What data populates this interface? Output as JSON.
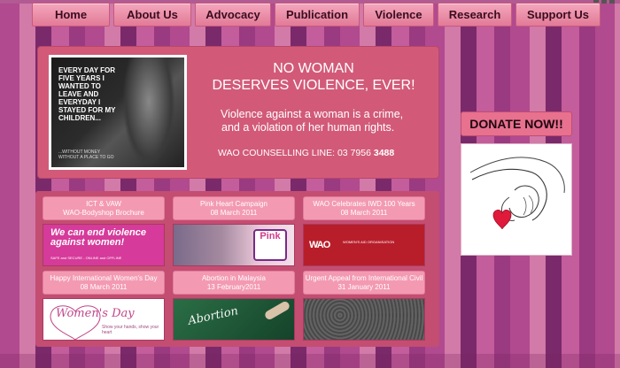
{
  "nav": {
    "items": [
      {
        "label": "Home"
      },
      {
        "label": "About Us"
      },
      {
        "label": "Advocacy"
      },
      {
        "label": "Publication"
      },
      {
        "label": "Violence"
      },
      {
        "label": "Research"
      },
      {
        "label": "Support Us"
      }
    ]
  },
  "hero": {
    "poster_text": "EVERY DAY FOR FIVE YEARS I WANTED TO LEAVE AND EVERYDAY I STAYED FOR MY CHILDREN...",
    "poster_small": "...WITHOUT MONEY WITHOUT A PLACE TO GO",
    "title_line1": "NO WOMAN",
    "title_line2": "DESERVES VIOLENCE, EVER!",
    "body_line1": "Violence against a woman is a crime,",
    "body_line2": "and a violation of her human rights.",
    "counselling_label": "WAO COUNSELLING LINE: 03 7956",
    "counselling_number": "3488"
  },
  "donate": {
    "label": "DONATE NOW!!"
  },
  "news": [
    {
      "title": "ICT & VAW",
      "subtitle": "WAO-Bodyshop Brochure",
      "thumb_text": "We can end violence against women!",
      "thumb_sub": "SAFE and SECURE - ONLINE and OFFLINE",
      "thumb_color": "#d63a9a"
    },
    {
      "title": "Pink Heart Campaign",
      "subtitle": "08 March 2011",
      "thumb_text": "Pink",
      "thumb_color": "#6b5a8a"
    },
    {
      "title": "WAO Celebrates IWD 100 Years",
      "subtitle": "08 March 2011",
      "thumb_text": "WAO",
      "thumb_sub": "WOMEN'S AID ORGANISATION",
      "thumb_color": "#b81e2a"
    },
    {
      "title": "Happy International Women's Day",
      "subtitle": "08 March 2011",
      "thumb_text": "Women's Day",
      "thumb_sub": "Show your hands, show your heart",
      "thumb_color": "#ffffff"
    },
    {
      "title": "Abortion in Malaysia",
      "subtitle": "13 February2011",
      "thumb_text": "Abortion",
      "thumb_color": "#1f5e3a"
    },
    {
      "title": "Urgent Appeal from International Civil",
      "subtitle": "31 January 2011",
      "thumb_color": "#5a5a5a"
    }
  ]
}
